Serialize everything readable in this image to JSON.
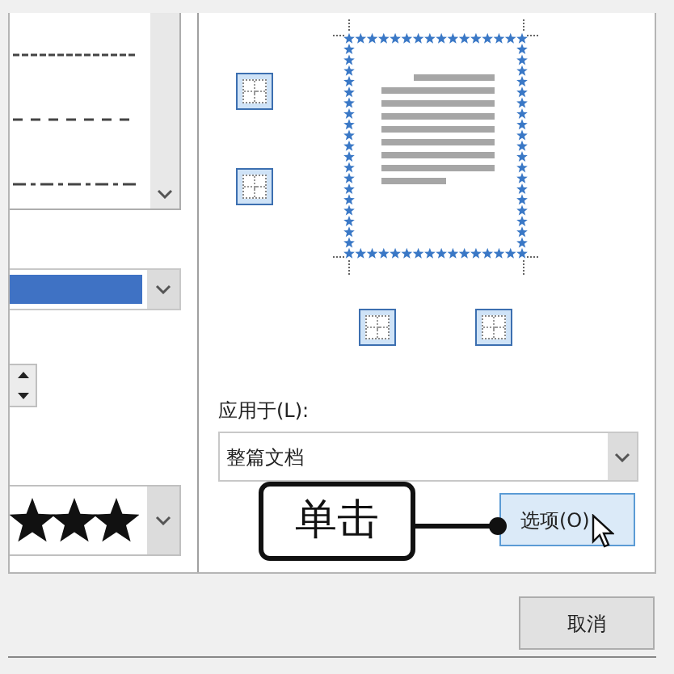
{
  "border_styles": [
    {
      "kind": "fine_dash"
    },
    {
      "kind": "dash"
    },
    {
      "kind": "dash_dot"
    }
  ],
  "apply_to": {
    "label": "应用于(L):",
    "value": "整篇文档"
  },
  "options_button": {
    "label": "选项(O)",
    "highlighted": true
  },
  "cancel_button": {
    "label": "取消"
  },
  "callout": {
    "text": "单击"
  }
}
